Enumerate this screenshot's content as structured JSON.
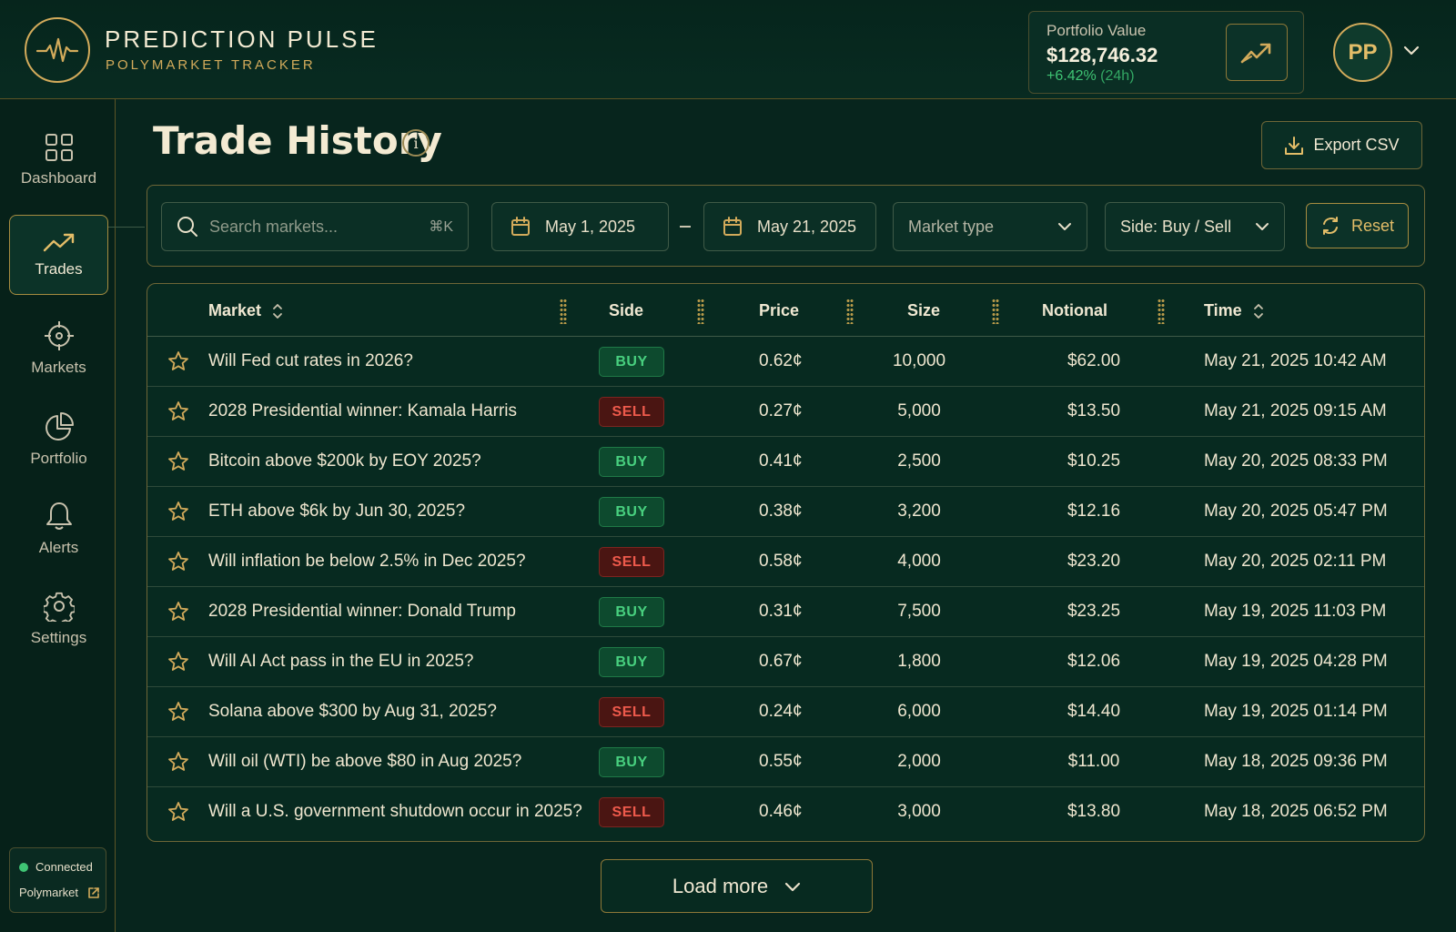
{
  "brand": {
    "title": "PREDICTION PULSE",
    "subtitle": "POLYMARKET TRACKER"
  },
  "portfolio": {
    "label": "Portfolio Value",
    "value": "$128,746.32",
    "change_pct": "+6.42%",
    "change_period": "(24h)"
  },
  "user": {
    "initials": "PP"
  },
  "sidebar": {
    "items": [
      {
        "label": "Dashboard",
        "icon": "grid-icon",
        "active": false
      },
      {
        "label": "Trades",
        "icon": "trend-up-icon",
        "active": true
      },
      {
        "label": "Markets",
        "icon": "crosshair-icon",
        "active": false
      },
      {
        "label": "Portfolio",
        "icon": "pie-chart-icon",
        "active": false
      },
      {
        "label": "Alerts",
        "icon": "bell-icon",
        "active": false
      },
      {
        "label": "Settings",
        "icon": "gear-icon",
        "active": false
      }
    ],
    "status": {
      "connected_label": "Connected",
      "link_label": "Polymarket"
    }
  },
  "page": {
    "title": "Trade History",
    "export_label": "Export CSV"
  },
  "filters": {
    "search_placeholder": "Search markets...",
    "search_shortcut": "⌘K",
    "date_from": "May 1, 2025",
    "date_to": "May 21, 2025",
    "market_type": "Market type",
    "side": "Side: Buy / Sell",
    "reset_label": "Reset"
  },
  "table": {
    "columns": {
      "market": "Market",
      "side": "Side",
      "price": "Price",
      "size": "Size",
      "notional": "Notional",
      "time": "Time"
    },
    "rows": [
      {
        "market": "Will Fed cut rates in 2026?",
        "side": "BUY",
        "price": "0.62¢",
        "size": "10,000",
        "notional": "$62.00",
        "time": "May 21, 2025 10:42 AM"
      },
      {
        "market": "2028 Presidential winner: Kamala Harris",
        "side": "SELL",
        "price": "0.27¢",
        "size": "5,000",
        "notional": "$13.50",
        "time": "May 21, 2025 09:15 AM"
      },
      {
        "market": "Bitcoin above $200k by EOY 2025?",
        "side": "BUY",
        "price": "0.41¢",
        "size": "2,500",
        "notional": "$10.25",
        "time": "May 20, 2025 08:33 PM"
      },
      {
        "market": "ETH above $6k by Jun 30, 2025?",
        "side": "BUY",
        "price": "0.38¢",
        "size": "3,200",
        "notional": "$12.16",
        "time": "May 20, 2025 05:47 PM"
      },
      {
        "market": "Will inflation be below 2.5% in Dec 2025?",
        "side": "SELL",
        "price": "0.58¢",
        "size": "4,000",
        "notional": "$23.20",
        "time": "May 20, 2025 02:11 PM"
      },
      {
        "market": "2028 Presidential winner: Donald Trump",
        "side": "BUY",
        "price": "0.31¢",
        "size": "7,500",
        "notional": "$23.25",
        "time": "May 19, 2025 11:03 PM"
      },
      {
        "market": "Will AI Act pass in the EU in 2025?",
        "side": "BUY",
        "price": "0.67¢",
        "size": "1,800",
        "notional": "$12.06",
        "time": "May 19, 2025 04:28 PM"
      },
      {
        "market": "Solana above $300 by Aug 31, 2025?",
        "side": "SELL",
        "price": "0.24¢",
        "size": "6,000",
        "notional": "$14.40",
        "time": "May 19, 2025 01:14 PM"
      },
      {
        "market": "Will oil (WTI) be above $80 in Aug 2025?",
        "side": "BUY",
        "price": "0.55¢",
        "size": "2,000",
        "notional": "$11.00",
        "time": "May 18, 2025 09:36 PM"
      },
      {
        "market": "Will a U.S. government shutdown occur in 2025?",
        "side": "SELL",
        "price": "0.46¢",
        "size": "3,000",
        "notional": "$13.80",
        "time": "May 18, 2025 06:52 PM"
      }
    ]
  },
  "load_more_label": "Load more",
  "colors": {
    "accent_gold": "#d3ab5b",
    "buy_green": "#48d07f",
    "sell_red": "#ee5a4c",
    "background": "#07251d"
  }
}
